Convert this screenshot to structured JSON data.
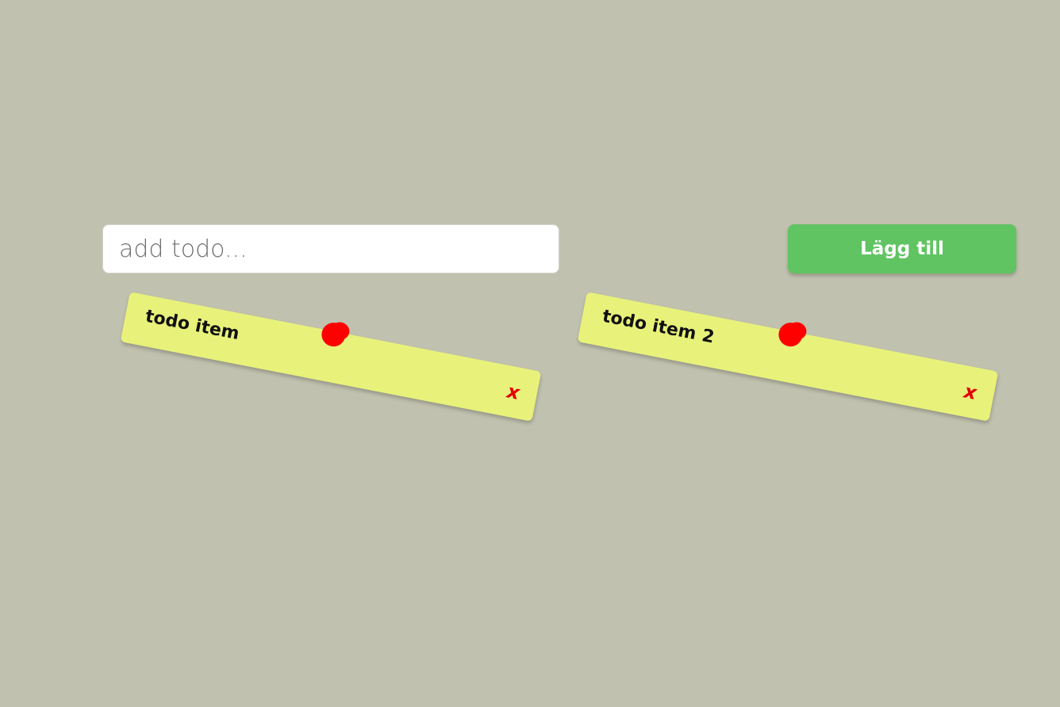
{
  "input": {
    "placeholder": "add todo...",
    "value": ""
  },
  "add_button": {
    "label": "Lägg till"
  },
  "todos": [
    {
      "label": "todo item",
      "delete_symbol": "x"
    },
    {
      "label": "todo item 2",
      "delete_symbol": "x"
    }
  ],
  "colors": {
    "background": "#c1c1af",
    "note": "#e8f27a",
    "pin": "#ff0000",
    "delete": "#e30000",
    "button": "#60c462"
  }
}
